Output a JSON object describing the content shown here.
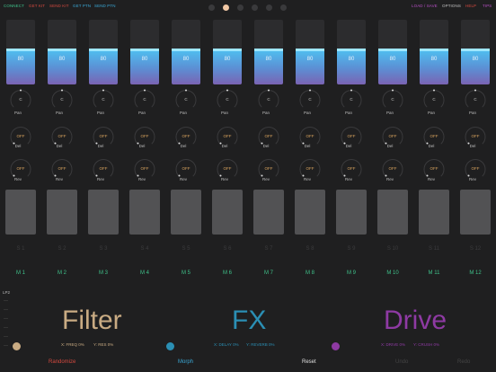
{
  "top_links_left": [
    {
      "label": "CONNECT",
      "color": "#3fc18a"
    },
    {
      "label": "GET KIT",
      "color": "#d5493f"
    },
    {
      "label": "SEND KIT",
      "color": "#d5493f"
    },
    {
      "label": "GET PTN",
      "color": "#3aa8d6"
    },
    {
      "label": "SEND PTN",
      "color": "#3aa8d6"
    }
  ],
  "top_links_right": [
    {
      "label": "LOAD / SAVE",
      "color": "#b44fc1"
    },
    {
      "label": "OPTIONS",
      "color": "#c0c0c0"
    },
    {
      "label": "HELP",
      "color": "#d5493f"
    },
    {
      "label": "TIPS",
      "color": "#b44fc1"
    }
  ],
  "page_indicator": {
    "count": 6,
    "active": 1
  },
  "tracks": [
    {
      "fader": "80",
      "pan": "C",
      "del": "OFF",
      "rev": "OFF",
      "s": "S 1",
      "m": "M 1"
    },
    {
      "fader": "80",
      "pan": "C",
      "del": "OFF",
      "rev": "OFF",
      "s": "S 2",
      "m": "M 2"
    },
    {
      "fader": "80",
      "pan": "C",
      "del": "OFF",
      "rev": "OFF",
      "s": "S 3",
      "m": "M 3"
    },
    {
      "fader": "80",
      "pan": "C",
      "del": "OFF",
      "rev": "OFF",
      "s": "S 4",
      "m": "M 4"
    },
    {
      "fader": "80",
      "pan": "C",
      "del": "OFF",
      "rev": "OFF",
      "s": "S 5",
      "m": "M 5"
    },
    {
      "fader": "80",
      "pan": "C",
      "del": "OFF",
      "rev": "OFF",
      "s": "S 6",
      "m": "M 6"
    },
    {
      "fader": "80",
      "pan": "C",
      "del": "OFF",
      "rev": "OFF",
      "s": "S 7",
      "m": "M 7"
    },
    {
      "fader": "80",
      "pan": "C",
      "del": "OFF",
      "rev": "OFF",
      "s": "S 8",
      "m": "M 8"
    },
    {
      "fader": "80",
      "pan": "C",
      "del": "OFF",
      "rev": "OFF",
      "s": "S 9",
      "m": "M 9"
    },
    {
      "fader": "80",
      "pan": "C",
      "del": "OFF",
      "rev": "OFF",
      "s": "S 10",
      "m": "M 10"
    },
    {
      "fader": "80",
      "pan": "C",
      "del": "OFF",
      "rev": "OFF",
      "s": "S 11",
      "m": "M 11"
    },
    {
      "fader": "80",
      "pan": "C",
      "del": "OFF",
      "rev": "OFF",
      "s": "S 12",
      "m": "M 12"
    }
  ],
  "fader_level": 0.55,
  "knob_labels": {
    "pan": "Pan",
    "del": "Del",
    "rev": "Rev"
  },
  "lp_label": "LP2",
  "sections": [
    {
      "title": "Filter",
      "x_label": "X: FREQ 0%",
      "y_label": "Y: RES 0%",
      "title_color": "#c9ab83",
      "xy_color": "#c9ab83",
      "ball_color": "#c9ab83"
    },
    {
      "title": "FX",
      "x_label": "X: DELAY 0%",
      "y_label": "Y: REVERB 0%",
      "title_color": "#2b8fb4",
      "xy_color": "#2b8fb4",
      "ball_color": "#2b8fb4"
    },
    {
      "title": "Drive",
      "x_label": "X: DRIVE 0%",
      "y_label": "Y: CRUSH 0%",
      "title_color": "#8e3aa3",
      "xy_color": "#8e3aa3",
      "ball_color": "#8e3aa3"
    }
  ],
  "bottom_buttons": [
    {
      "label": "Randomize",
      "color": "#d5493f"
    },
    {
      "label": "Morph",
      "color": "#3aa8d6"
    },
    {
      "label": "Reset",
      "color": "#e0e0e0"
    },
    {
      "label": "Undo",
      "color": "#444"
    },
    {
      "label": "Redo",
      "color": "#444"
    }
  ]
}
